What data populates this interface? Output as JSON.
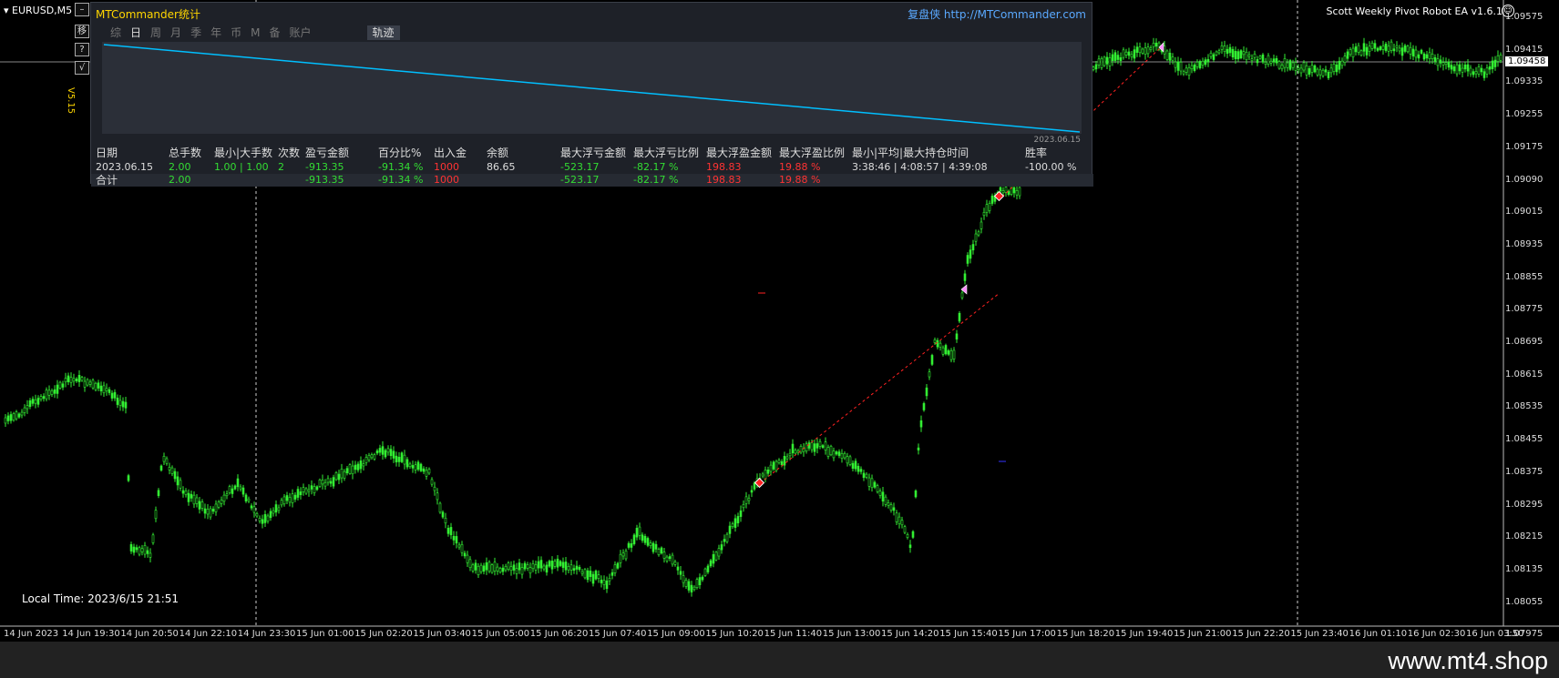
{
  "chart": {
    "symbol_timeframe": "EURUSD,M5",
    "ea_title": "Scott Weekly Pivot Robot EA  v1.6.1",
    "version_label": "V5.15",
    "local_time": "Local Time: 2023/6/15 21:51",
    "current_price": "1.09458",
    "price_axis": [
      "1.09575",
      "1.09415",
      "1.09335",
      "1.09255",
      "1.09175",
      "1.09090",
      "1.09015",
      "1.08935",
      "1.08855",
      "1.08775",
      "1.08695",
      "1.08615",
      "1.08535",
      "1.08455",
      "1.08375",
      "1.08295",
      "1.08215",
      "1.08135",
      "1.08055",
      "1.07975"
    ],
    "time_axis": [
      "14 Jun 2023",
      "14 Jun 19:30",
      "14 Jun 20:50",
      "14 Jun 22:10",
      "14 Jun 23:30",
      "15 Jun 01:00",
      "15 Jun 02:20",
      "15 Jun 03:40",
      "15 Jun 05:00",
      "15 Jun 06:20",
      "15 Jun 07:40",
      "15 Jun 09:00",
      "15 Jun 10:20",
      "15 Jun 11:40",
      "15 Jun 13:00",
      "15 Jun 14:20",
      "15 Jun 15:40",
      "15 Jun 17:00",
      "15 Jun 18:20",
      "15 Jun 19:40",
      "15 Jun 21:00",
      "15 Jun 22:20",
      "15 Jun 23:40",
      "16 Jun 01:10",
      "16 Jun 02:30",
      "16 Jun 03:50"
    ],
    "side_buttons": [
      "–",
      "移",
      "?",
      "√"
    ],
    "colors": {
      "candle": "#33ee33",
      "trade_line": "#ff2222",
      "equity_line": "#00bfff"
    }
  },
  "stats_panel": {
    "title": "MTCommander统计",
    "link": "复盘侠 http://MTCommander.com",
    "tabs": [
      "综",
      "日",
      "周",
      "月",
      "季",
      "年",
      "币",
      "M",
      "备",
      "账户",
      "轨迹"
    ],
    "active_tab": "日",
    "equity_end_date": "2023.06.15",
    "columns": [
      "日期",
      "总手数",
      "最小|大手数",
      "次数",
      "盈亏金额",
      "百分比%",
      "出入金",
      "余额",
      "最大浮亏金额",
      "最大浮亏比例",
      "最大浮盈金额",
      "最大浮盈比例",
      "最小|平均|最大持仓时间",
      "胜率"
    ],
    "rows": [
      [
        "2023.06.15",
        "2.00",
        "1.00 | 1.00",
        "2",
        "-913.35",
        "-91.34 %",
        "1000",
        "86.65",
        "-523.17",
        "-82.17 %",
        "198.83",
        "19.88 %",
        "3:38:46 | 4:08:57 | 4:39:08",
        "-100.00 %"
      ]
    ],
    "total_row": [
      "合计",
      "2.00",
      "",
      "",
      "-913.35",
      "-91.34 %",
      "1000",
      "",
      "-523.17",
      "-82.17 %",
      "198.83",
      "19.88 %",
      "",
      ""
    ]
  },
  "footer": {
    "watermark": "www.mt4.shop"
  }
}
